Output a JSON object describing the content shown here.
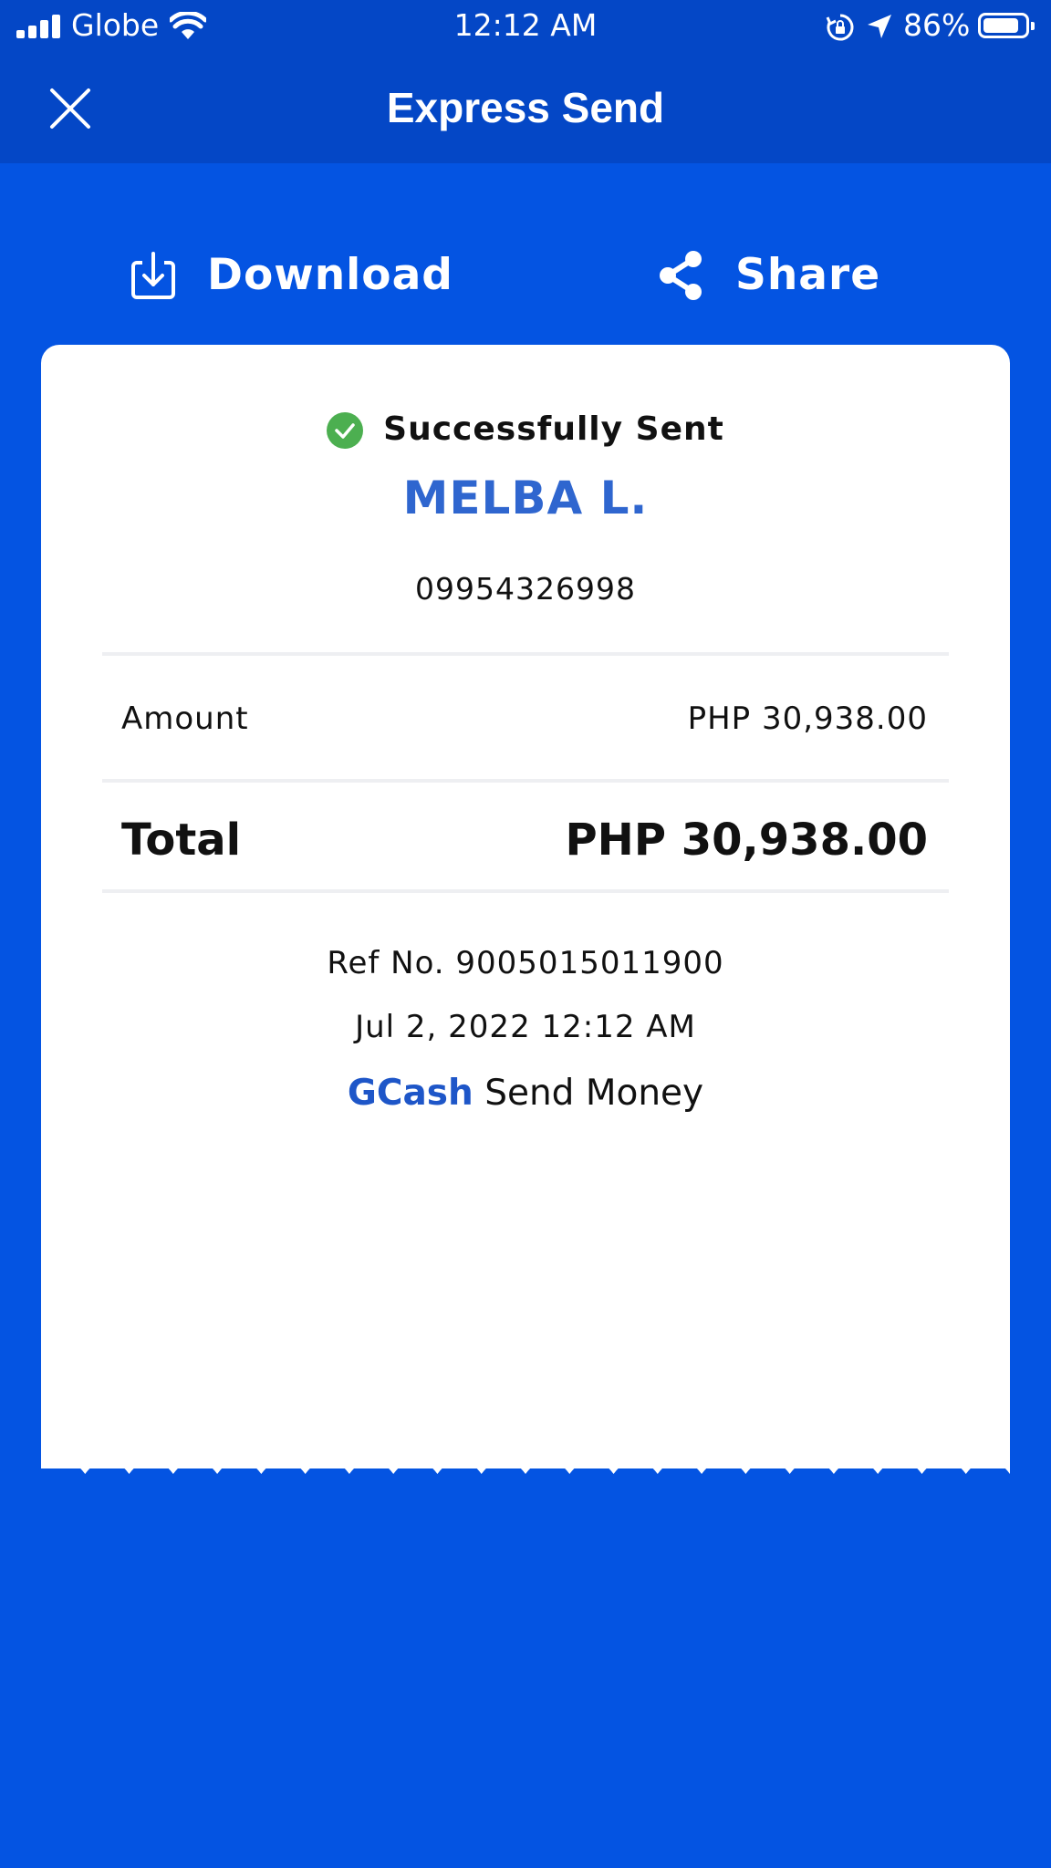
{
  "status_bar": {
    "carrier": "Globe",
    "time": "12:12 AM",
    "battery_percent": "86%",
    "battery_level": 0.86
  },
  "header": {
    "title": "Express Send",
    "close_icon": "close-icon"
  },
  "actions": {
    "download_label": "Download",
    "share_label": "Share"
  },
  "receipt": {
    "status": "Successfully Sent",
    "recipient_name": "MELBA L.",
    "recipient_number": "09954326998",
    "amount_label": "Amount",
    "amount_value": "PHP 30,938.00",
    "total_label": "Total",
    "total_value": "PHP 30,938.00",
    "reference": "Ref No. 9005015011900",
    "datetime": "Jul 2, 2022 12:12 AM",
    "brand_name": "GCash",
    "service": "Send Money"
  },
  "colors": {
    "background": "#0454e2",
    "header": "#0447c6",
    "accent_name": "#2f66cf",
    "success_green": "#4caf50",
    "brand_blue": "#1e56c8"
  }
}
